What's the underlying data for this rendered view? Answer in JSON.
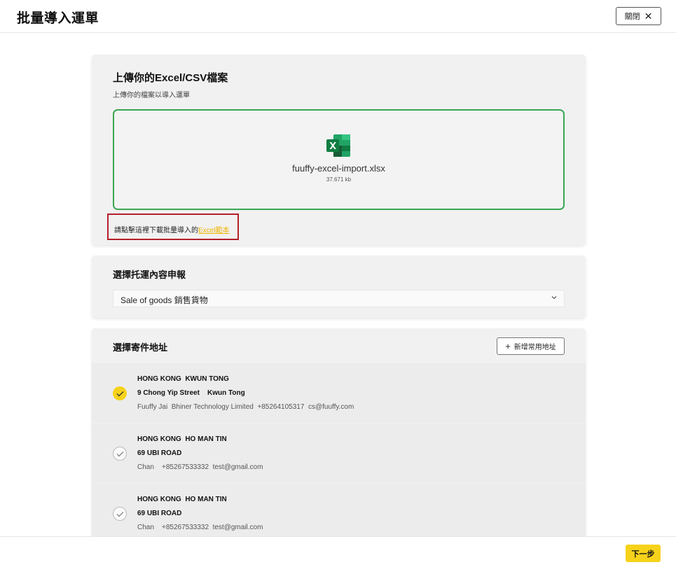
{
  "header": {
    "title": "批量導入運單",
    "close_label": "關閉"
  },
  "upload": {
    "title": "上傳你的Excel/CSV檔案",
    "subtitle": "上傳你的檔案以導入運單",
    "file_name": "fuuffy-excel-import.xlsx",
    "file_size": "37.671 kb",
    "template_prefix": "請點擊這裡下載批量導入的",
    "template_link": "Excel範本"
  },
  "declaration": {
    "title": "選擇托運內容申報",
    "selected": "Sale of goods 銷售貨物"
  },
  "address": {
    "title": "選擇寄件地址",
    "add_label": "新增常用地址",
    "items": [
      {
        "line1": "HONG KONG  KWUN TONG",
        "line2": "9 Chong Yip Street    Kwun Tong",
        "line3": "Fuuffy Jai  Bhiner Technology Limited  +85264105317  cs@fuuffy.com",
        "selected": true
      },
      {
        "line1": "HONG KONG  HO MAN TIN",
        "line2": "69 UBI ROAD",
        "line3": "Chan    +85267533332  test@gmail.com",
        "selected": false
      },
      {
        "line1": "HONG KONG  HO MAN TIN",
        "line2": "69 UBI ROAD",
        "line3": "Chan    +85267533332  test@gmail.com",
        "selected": false
      }
    ]
  },
  "footer": {
    "next_label": "下一步"
  },
  "colors": {
    "accent_yellow": "#f7d21b",
    "dropzone_border": "#3aa655",
    "highlight_box": "#b3202a",
    "link": "#f0b400"
  },
  "icons": {
    "close": "close-icon",
    "excel": "excel-file-icon",
    "chevron": "chevron-down-icon",
    "plus": "plus-icon",
    "check": "check-icon"
  }
}
